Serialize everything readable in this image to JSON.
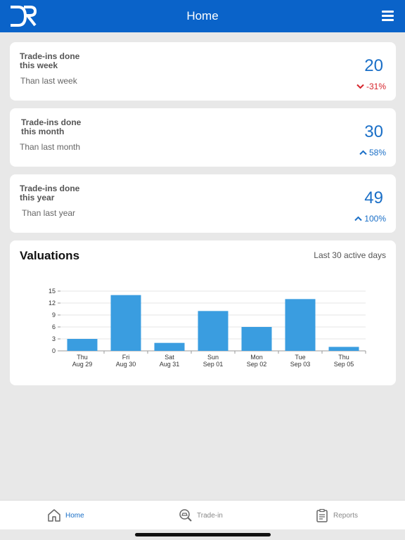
{
  "header": {
    "title": "Home",
    "logo_text": "DR"
  },
  "stats": [
    {
      "label": "Trade-ins done this week",
      "sub": "Than last week",
      "value": "20",
      "change": "-31%",
      "direction": "down"
    },
    {
      "label": "Trade-ins done this month",
      "sub": "Than last month",
      "value": "30",
      "change": "58%",
      "direction": "up"
    },
    {
      "label": "Trade-ins done this year",
      "sub": "Than last year",
      "value": "49",
      "change": "100%",
      "direction": "up"
    }
  ],
  "valuations": {
    "title": "Valuations",
    "range": "Last 30 active days"
  },
  "chart_data": {
    "type": "bar",
    "categories": [
      [
        "Thu",
        "Aug 29"
      ],
      [
        "Fri",
        "Aug 30"
      ],
      [
        "Sat",
        "Aug 31"
      ],
      [
        "Sun",
        "Sep 01"
      ],
      [
        "Mon",
        "Sep 02"
      ],
      [
        "Tue",
        "Sep 03"
      ],
      [
        "Thu",
        "Sep 05"
      ]
    ],
    "values": [
      3,
      14,
      2,
      10,
      6,
      13,
      1
    ],
    "ylim": [
      0,
      15
    ],
    "yticks": [
      0,
      3,
      6,
      9,
      12,
      15
    ],
    "grid": true,
    "color": "#3a9de0"
  },
  "nav": [
    {
      "label": "Home",
      "icon": "home-icon",
      "active": true
    },
    {
      "label": "Trade-in",
      "icon": "car-search-icon",
      "active": false
    },
    {
      "label": "Reports",
      "icon": "clipboard-icon",
      "active": false
    }
  ],
  "colors": {
    "primary": "#0a63c9",
    "accent": "#1a6fc7",
    "negative": "#d6232a"
  }
}
